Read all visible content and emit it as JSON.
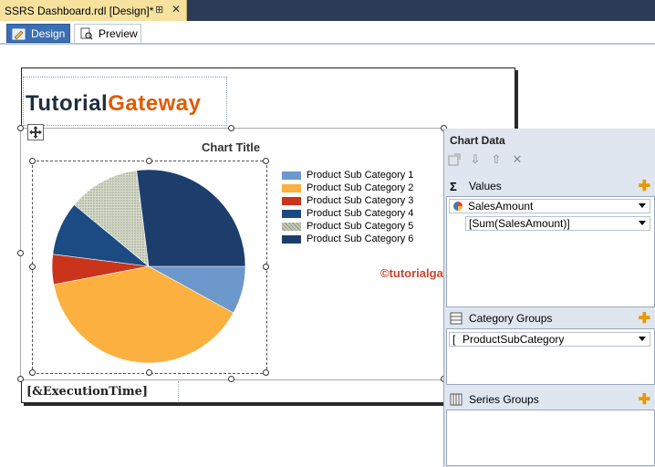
{
  "document_tab": {
    "title": "SSRS Dashboard.rdl [Design]*",
    "pin": "⊞",
    "close": "✕"
  },
  "view_tabs": [
    {
      "label": "Design",
      "icon": "design-icon",
      "active": true
    },
    {
      "label": "Preview",
      "icon": "preview-icon",
      "active": false
    }
  ],
  "report": {
    "logo": {
      "part1": "Tutorial",
      "part2": "Gateway"
    },
    "execution_time": "[&ExecutionTime]",
    "watermark": "©tutorialgateway.org"
  },
  "chart_data": {
    "type": "pie",
    "title": "Chart Title",
    "categories": [
      "Product Sub Category 1",
      "Product Sub Category 2",
      "Product Sub Category 3",
      "Product Sub Category 4",
      "Product Sub Category 5",
      "Product Sub Category 6"
    ],
    "values": [
      8,
      39,
      5,
      9,
      12,
      27
    ],
    "colors": [
      "#6d98cc",
      "#fbb040",
      "#c9341a",
      "#1c4a82",
      "#c5cbb8",
      "#1d3e6c"
    ],
    "legend": "right"
  },
  "chart_data_pane": {
    "title": "Chart Data",
    "toolbar": [
      "properties-icon",
      "move-down-icon",
      "move-up-icon",
      "delete-icon"
    ],
    "values": {
      "label": "Values",
      "field": "SalesAmount",
      "expression": "[Sum(SalesAmount)]"
    },
    "category_groups": {
      "label": "Category Groups",
      "field": "ProductSubCategory"
    },
    "series_groups": {
      "label": "Series Groups"
    }
  }
}
